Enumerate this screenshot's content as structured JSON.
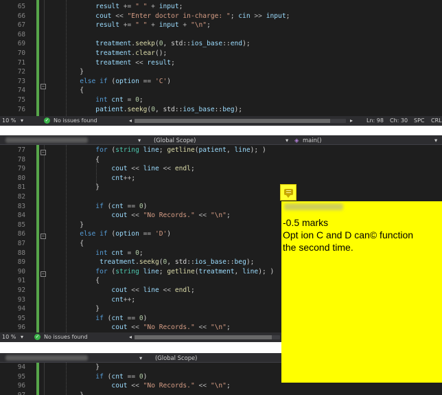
{
  "pane1": {
    "zoom": "10 %",
    "status": "No issues found",
    "cursor": {
      "ln": "Ln: 98",
      "ch": "Ch: 30",
      "spc": "SPC",
      "eol": "CRLF"
    },
    "lines": [
      {
        "n": "65",
        "indent": 0,
        "segs": [
          [
            "vr",
            "            result"
          ],
          [
            "op",
            " += "
          ],
          [
            "st",
            "\" \""
          ],
          [
            "op",
            " + "
          ],
          [
            "vr",
            "input"
          ],
          [
            "pl",
            ";"
          ]
        ]
      },
      {
        "n": "66",
        "segs": [
          [
            "vr",
            "            cout"
          ],
          [
            "op",
            " << "
          ],
          [
            "st",
            "\"Enter doctor in-charge: \""
          ],
          [
            "pl",
            "; "
          ],
          [
            "vr",
            "cin"
          ],
          [
            "op",
            " >> "
          ],
          [
            "vr",
            "input"
          ],
          [
            "pl",
            ";"
          ]
        ]
      },
      {
        "n": "67",
        "segs": [
          [
            "vr",
            "            result"
          ],
          [
            "op",
            " += "
          ],
          [
            "st",
            "\" \""
          ],
          [
            "op",
            " + "
          ],
          [
            "vr",
            "input"
          ],
          [
            "op",
            " + "
          ],
          [
            "st",
            "\"\\n\""
          ],
          [
            "pl",
            ";"
          ]
        ]
      },
      {
        "n": "68",
        "segs": []
      },
      {
        "n": "69",
        "segs": [
          [
            "vr",
            "            treatment"
          ],
          [
            "pl",
            "."
          ],
          [
            "fn",
            "seekp"
          ],
          [
            "pl",
            "("
          ],
          [
            "nm",
            "0"
          ],
          [
            "pl",
            ", std::"
          ],
          [
            "vr",
            "ios_base"
          ],
          [
            "pl",
            "::"
          ],
          [
            "vr",
            "end"
          ],
          [
            "pl",
            ");"
          ]
        ]
      },
      {
        "n": "70",
        "segs": [
          [
            "vr",
            "            treatment"
          ],
          [
            "pl",
            "."
          ],
          [
            "fn",
            "clear"
          ],
          [
            "pl",
            "();"
          ]
        ]
      },
      {
        "n": "71",
        "segs": [
          [
            "vr",
            "            treatment"
          ],
          [
            "op",
            " << "
          ],
          [
            "vr",
            "result"
          ],
          [
            "pl",
            ";"
          ]
        ]
      },
      {
        "n": "72",
        "segs": [
          [
            "pl",
            "        }"
          ]
        ]
      },
      {
        "n": "73",
        "segs": [
          [
            "kw",
            "        else if"
          ],
          [
            "pl",
            " ("
          ],
          [
            "vr",
            "option"
          ],
          [
            "op",
            " == "
          ],
          [
            "st",
            "'C'"
          ],
          [
            "pl",
            ")"
          ]
        ]
      },
      {
        "n": "74",
        "segs": [
          [
            "pl",
            "        {"
          ]
        ]
      },
      {
        "n": "75",
        "segs": [
          [
            "kw",
            "            int"
          ],
          [
            "vr",
            " cnt"
          ],
          [
            "op",
            " = "
          ],
          [
            "nm",
            "0"
          ],
          [
            "pl",
            ";"
          ]
        ]
      },
      {
        "n": "76",
        "segs": [
          [
            "vr",
            "            patient"
          ],
          [
            "pl",
            "."
          ],
          [
            "fn",
            "seekg"
          ],
          [
            "pl",
            "("
          ],
          [
            "nm",
            "0"
          ],
          [
            "pl",
            ", std::"
          ],
          [
            "vr",
            "ios_base"
          ],
          [
            "pl",
            "::"
          ],
          [
            "vr",
            "beg"
          ],
          [
            "pl",
            ");"
          ]
        ]
      }
    ]
  },
  "pane2": {
    "scope": "(Global Scope)",
    "function": "main()",
    "zoom": "10 %",
    "status": "No issues found",
    "lines": [
      {
        "n": "77",
        "segs": [
          [
            "kw",
            "            for"
          ],
          [
            "pl",
            " ("
          ],
          [
            "ty",
            "string"
          ],
          [
            "vr",
            " line"
          ],
          [
            "pl",
            "; "
          ],
          [
            "fn",
            "getline"
          ],
          [
            "pl",
            "("
          ],
          [
            "vr",
            "patient"
          ],
          [
            "pl",
            ", "
          ],
          [
            "vr",
            "line"
          ],
          [
            "pl",
            "); )"
          ]
        ]
      },
      {
        "n": "78",
        "segs": [
          [
            "pl",
            "            {"
          ]
        ]
      },
      {
        "n": "79",
        "segs": [
          [
            "vr",
            "                cout"
          ],
          [
            "op",
            " << "
          ],
          [
            "vr",
            "line"
          ],
          [
            "op",
            " << "
          ],
          [
            "fn",
            "endl"
          ],
          [
            "pl",
            ";"
          ]
        ]
      },
      {
        "n": "80",
        "segs": [
          [
            "vr",
            "                cnt"
          ],
          [
            "op",
            "++"
          ],
          [
            "pl",
            ";"
          ]
        ]
      },
      {
        "n": "81",
        "segs": [
          [
            "pl",
            "            }"
          ]
        ]
      },
      {
        "n": "82",
        "segs": []
      },
      {
        "n": "83",
        "segs": [
          [
            "kw",
            "            if"
          ],
          [
            "pl",
            " ("
          ],
          [
            "vr",
            "cnt"
          ],
          [
            "op",
            " == "
          ],
          [
            "nm",
            "0"
          ],
          [
            "pl",
            ")"
          ]
        ]
      },
      {
        "n": "84",
        "segs": [
          [
            "vr",
            "                cout"
          ],
          [
            "op",
            " << "
          ],
          [
            "st",
            "\"No Records.\""
          ],
          [
            "op",
            " << "
          ],
          [
            "st",
            "\"\\n\""
          ],
          [
            "pl",
            ";"
          ]
        ]
      },
      {
        "n": "85",
        "segs": [
          [
            "pl",
            "        }"
          ]
        ]
      },
      {
        "n": "86",
        "segs": [
          [
            "kw",
            "        else if"
          ],
          [
            "pl",
            " ("
          ],
          [
            "vr",
            "option"
          ],
          [
            "op",
            " == "
          ],
          [
            "st",
            "'D'"
          ],
          [
            "pl",
            ")"
          ]
        ]
      },
      {
        "n": "87",
        "segs": [
          [
            "pl",
            "        {"
          ]
        ]
      },
      {
        "n": "88",
        "segs": [
          [
            "kw",
            "            int"
          ],
          [
            "vr",
            " cnt"
          ],
          [
            "op",
            " = "
          ],
          [
            "nm",
            "0"
          ],
          [
            "pl",
            ";"
          ]
        ]
      },
      {
        "n": "89",
        "segs": [
          [
            "vr",
            "             treatment"
          ],
          [
            "pl",
            "."
          ],
          [
            "fn",
            "seekg"
          ],
          [
            "pl",
            "("
          ],
          [
            "nm",
            "0"
          ],
          [
            "pl",
            ", std::"
          ],
          [
            "vr",
            "ios_base"
          ],
          [
            "pl",
            "::"
          ],
          [
            "vr",
            "beg"
          ],
          [
            "pl",
            ");"
          ]
        ]
      },
      {
        "n": "90",
        "segs": [
          [
            "kw",
            "            for"
          ],
          [
            "pl",
            " ("
          ],
          [
            "ty",
            "string"
          ],
          [
            "vr",
            " line"
          ],
          [
            "pl",
            "; "
          ],
          [
            "fn",
            "getline"
          ],
          [
            "pl",
            "("
          ],
          [
            "vr",
            "treatment"
          ],
          [
            "pl",
            ", "
          ],
          [
            "vr",
            "line"
          ],
          [
            "pl",
            "); )"
          ]
        ]
      },
      {
        "n": "91",
        "segs": [
          [
            "pl",
            "            {"
          ]
        ]
      },
      {
        "n": "92",
        "segs": [
          [
            "vr",
            "                cout"
          ],
          [
            "op",
            " << "
          ],
          [
            "vr",
            "line"
          ],
          [
            "op",
            " << "
          ],
          [
            "fn",
            "endl"
          ],
          [
            "pl",
            ";"
          ]
        ]
      },
      {
        "n": "93",
        "segs": [
          [
            "vr",
            "                cnt"
          ],
          [
            "op",
            "++"
          ],
          [
            "pl",
            ";"
          ]
        ]
      },
      {
        "n": "94",
        "segs": [
          [
            "pl",
            "            }"
          ]
        ]
      },
      {
        "n": "95",
        "segs": [
          [
            "kw",
            "            if"
          ],
          [
            "pl",
            " ("
          ],
          [
            "vr",
            "cnt"
          ],
          [
            "op",
            " == "
          ],
          [
            "nm",
            "0"
          ],
          [
            "pl",
            ")"
          ]
        ]
      },
      {
        "n": "96",
        "segs": [
          [
            "vr",
            "                cout"
          ],
          [
            "op",
            " << "
          ],
          [
            "st",
            "\"No Records.\""
          ],
          [
            "op",
            " << "
          ],
          [
            "st",
            "\"\\n\""
          ],
          [
            "pl",
            ";"
          ]
        ]
      }
    ]
  },
  "pane3": {
    "scope": "(Global Scope)",
    "lines": [
      {
        "n": "94",
        "segs": [
          [
            "pl",
            "            }"
          ]
        ]
      },
      {
        "n": "95",
        "segs": [
          [
            "kw",
            "            if"
          ],
          [
            "pl",
            " ("
          ],
          [
            "vr",
            "cnt"
          ],
          [
            "op",
            " == "
          ],
          [
            "nm",
            "0"
          ],
          [
            "pl",
            ")"
          ]
        ]
      },
      {
        "n": "96",
        "segs": [
          [
            "vr",
            "                cout"
          ],
          [
            "op",
            " << "
          ],
          [
            "st",
            "\"No Records.\""
          ],
          [
            "op",
            " << "
          ],
          [
            "st",
            "\"\\n\""
          ],
          [
            "pl",
            ";"
          ]
        ]
      },
      {
        "n": "97",
        "segs": [
          [
            "pl",
            "        }"
          ]
        ]
      }
    ]
  },
  "comment": {
    "line1": "-0.5 marks",
    "line2": "Opt ion C and D can© function",
    "line3": "the second time."
  },
  "icons": {
    "ok": "check-circle-icon",
    "note": "comment-note-icon",
    "fold": "collapse-minus-icon",
    "function": "function-cube-icon"
  },
  "colors": {
    "editor_bg": "#1e1e1e",
    "comment_bg": "#ffff00",
    "change_bar": "#57a64a"
  }
}
